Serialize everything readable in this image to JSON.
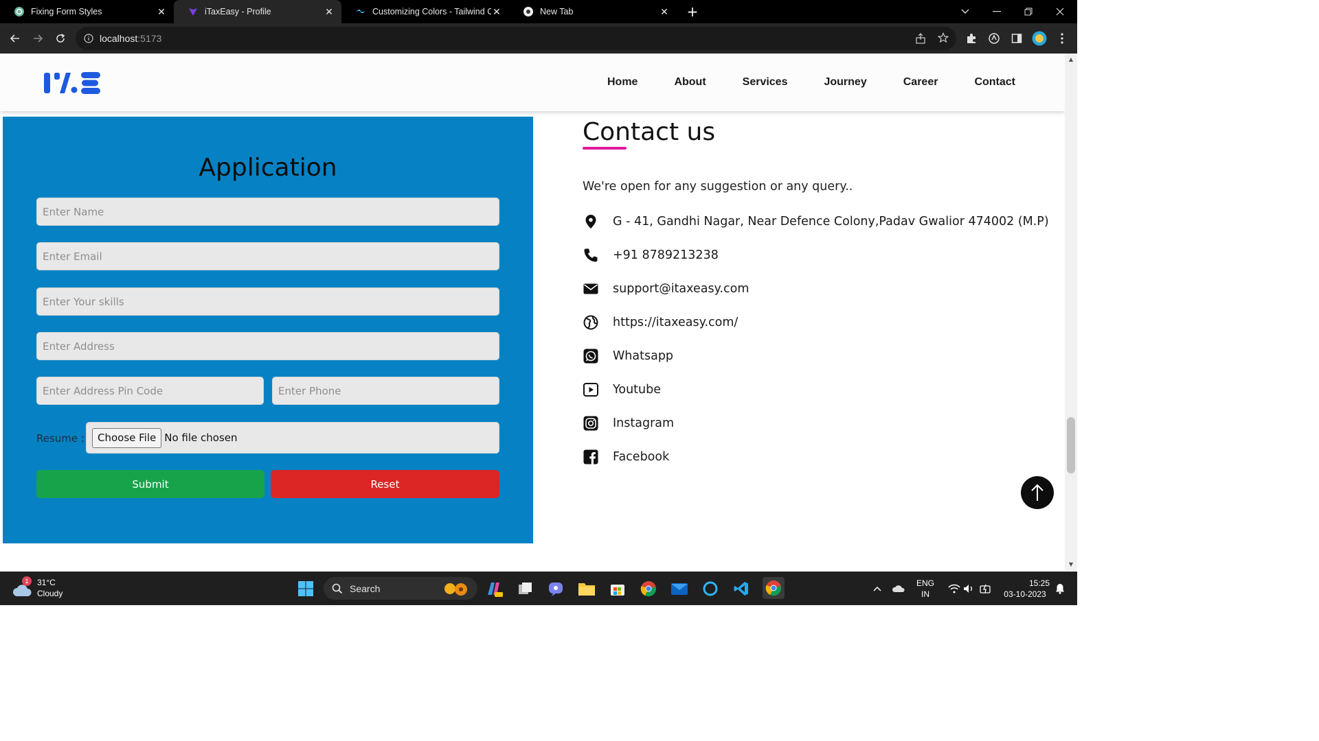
{
  "browser": {
    "tabs": [
      {
        "title": "Fixing Form Styles",
        "icon": "chatgpt-icon",
        "active": false
      },
      {
        "title": "iTaxEasy - Profile",
        "icon": "vite-icon",
        "active": true
      },
      {
        "title": "Customizing Colors - Tailwind CSS",
        "icon": "tailwind-icon",
        "active": false
      },
      {
        "title": "New Tab",
        "icon": "chrome-icon",
        "active": false
      }
    ],
    "close_glyph": "✕",
    "new_tab_glyph": "+",
    "url_host": "localhost",
    "url_port": ":5173"
  },
  "nav": {
    "links": [
      "Home",
      "About",
      "Services",
      "Journey",
      "Career",
      "Contact"
    ]
  },
  "application": {
    "title": "Application",
    "placeholders": {
      "name": "Enter Name",
      "email": "Enter Email",
      "skills": "Enter Your skills",
      "address": "Enter Address",
      "pincode": "Enter Address Pin Code",
      "phone": "Enter Phone"
    },
    "resume_label": "Resume :",
    "choose_file_label": "Choose File",
    "no_file_text": "No file chosen",
    "submit_label": "Submit",
    "reset_label": "Reset",
    "colors": {
      "panel": "#0682c4",
      "submit": "#16a34a",
      "reset": "#dc2626"
    }
  },
  "contact": {
    "title": "Contact us",
    "subtitle": "We're open for any suggestion or any query..",
    "items": [
      {
        "icon": "location-pin-icon",
        "text": "G - 41, Gandhi Nagar, Near Defence Colony,Padav Gwalior 474002 (M.P)"
      },
      {
        "icon": "phone-icon",
        "text": "+91 8789213238"
      },
      {
        "icon": "envelope-icon",
        "text": "support@itaxeasy.com"
      },
      {
        "icon": "globe-icon",
        "text": "https://itaxeasy.com/"
      },
      {
        "icon": "whatsapp-icon",
        "text": "Whatsapp"
      },
      {
        "icon": "youtube-icon",
        "text": "Youtube"
      },
      {
        "icon": "instagram-icon",
        "text": "Instagram"
      },
      {
        "icon": "facebook-icon",
        "text": "Facebook"
      }
    ],
    "accent": "#e0189a"
  },
  "taskbar": {
    "weather_temp": "31°C",
    "weather_desc": "Cloudy",
    "weather_badge": "1",
    "search_label": "Search",
    "lang_top": "ENG",
    "lang_bottom": "IN",
    "time": "15:25",
    "date": "03-10-2023"
  }
}
